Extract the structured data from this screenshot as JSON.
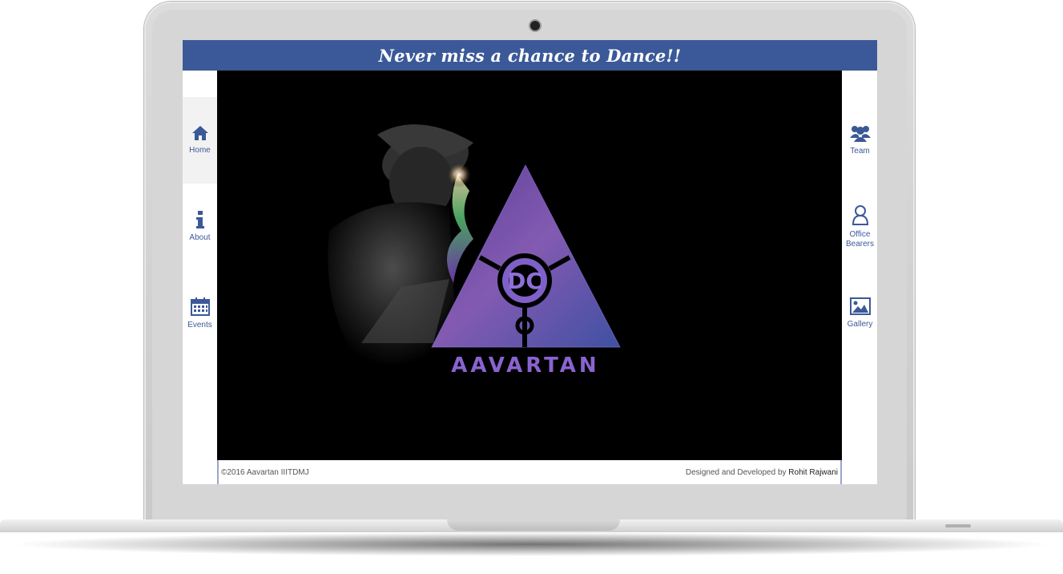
{
  "banner": {
    "text": "Never miss a chance to Dance!!"
  },
  "nav_left": [
    {
      "label": "Home",
      "icon": "home-icon",
      "active": true
    },
    {
      "label": "About",
      "icon": "info-icon",
      "active": false
    },
    {
      "label": "Events",
      "icon": "calendar-icon",
      "active": false
    }
  ],
  "nav_right": [
    {
      "label": "Team",
      "icon": "team-icon"
    },
    {
      "label": "Office Bearers",
      "icon": "user-icon"
    },
    {
      "label": "Gallery",
      "icon": "picture-icon"
    }
  ],
  "hero": {
    "logo_text": "AAVARTAN"
  },
  "footer": {
    "copyright": "©2016 Aavartan IIITDMJ",
    "credit_prefix": "Designed and Developed by",
    "credit_name": "Rohit Rajwani"
  },
  "colors": {
    "brand": "#3b5998",
    "hero_bg": "#000000"
  }
}
